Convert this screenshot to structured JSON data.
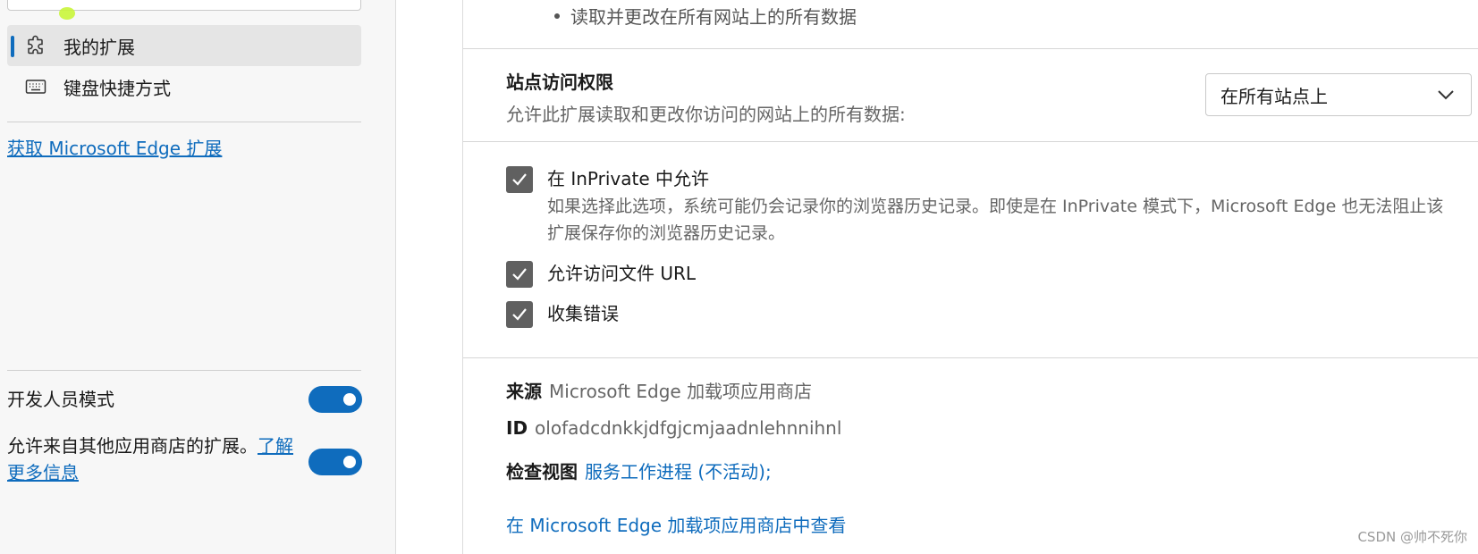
{
  "sidebar": {
    "items": [
      {
        "label": "我的扩展",
        "icon": "puzzle-icon",
        "active": true
      },
      {
        "label": "键盘快捷方式",
        "icon": "keyboard-icon",
        "active": false
      }
    ],
    "get_extensions_link": "获取 Microsoft Edge 扩展",
    "developer_mode": {
      "label": "开发人员模式",
      "on": true
    },
    "allow_other_stores": {
      "label": "允许来自其他应用商店的扩展。",
      "link": "了解更多信息",
      "on": true
    }
  },
  "main": {
    "permission_item": "读取并更改在所有网站上的所有数据",
    "site_access": {
      "title": "站点访问权限",
      "description": "允许此扩展读取和更改你访问的网站上的所有数据:",
      "selected": "在所有站点上"
    },
    "options": [
      {
        "label": "在 InPrivate 中允许",
        "description": "如果选择此选项，系统可能仍会记录你的浏览器历史记录。即使是在 InPrivate 模式下，Microsoft Edge 也无法阻止该扩展保存你的浏览器历史记录。",
        "checked": true
      },
      {
        "label": "允许访问文件 URL",
        "checked": true
      },
      {
        "label": "收集错误",
        "checked": true
      }
    ],
    "source": {
      "label": "来源",
      "value": "Microsoft Edge 加载项应用商店"
    },
    "id": {
      "label": "ID",
      "value": "olofadcdnkkjdfgjcmjaadnlehnnihnl"
    },
    "inspect": {
      "label": "检查视图",
      "link": "服务工作进程 (不活动);"
    },
    "store_link": "在 Microsoft Edge 加载项应用商店中查看"
  },
  "watermark": "CSDN @帅不死你",
  "colors": {
    "accent": "#0f6cbd",
    "checkbox": "#606060",
    "sidebar_bg": "#f7f7f7"
  }
}
